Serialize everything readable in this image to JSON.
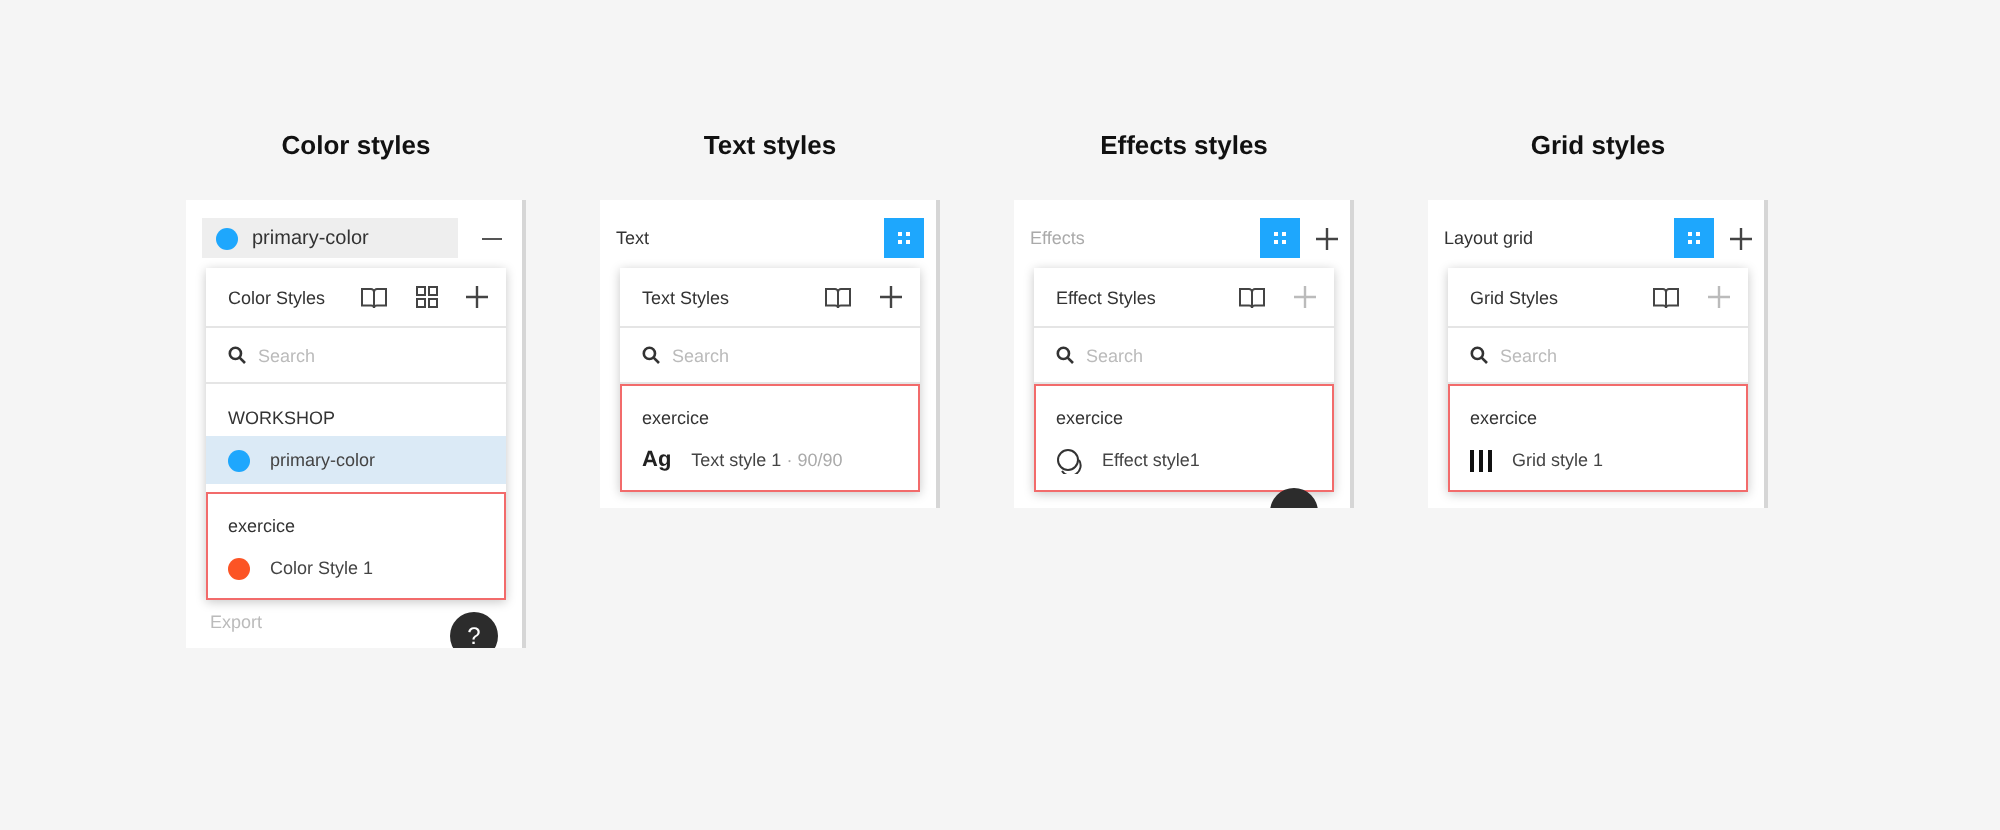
{
  "panels": [
    {
      "heading": "Color styles",
      "section": {
        "kind": "swatch-field",
        "label": "primary-color",
        "color": "#1ea7fd",
        "plus": false
      },
      "popup": {
        "title": "Color Styles",
        "tools": [
          {
            "kind": "library"
          },
          {
            "kind": "grid"
          },
          {
            "kind": "add",
            "disabled": false
          }
        ],
        "placeholder": "Search",
        "groups": [
          {
            "name": "WORKSHOP",
            "highlighted": false,
            "items": [
              {
                "kind": "color",
                "color": "#1ea7fd",
                "label": "primary-color",
                "selected": true
              }
            ]
          },
          {
            "name": "exercice",
            "highlighted": true,
            "items": [
              {
                "kind": "color",
                "color": "#fc5425",
                "label": "Color Style 1",
                "selected": false
              }
            ]
          }
        ]
      },
      "footer": "Export",
      "help": "?"
    },
    {
      "heading": "Text styles",
      "section": {
        "kind": "label",
        "label": "Text",
        "disabled": false,
        "plus": false
      },
      "popup": {
        "title": "Text Styles",
        "tools": [
          {
            "kind": "library"
          },
          {
            "kind": "add",
            "disabled": false
          }
        ],
        "placeholder": "Search",
        "groups": [
          {
            "name": "exercice",
            "highlighted": true,
            "items": [
              {
                "kind": "text",
                "glyph": "Ag",
                "label": "Text style 1",
                "detail": "· 90/90",
                "selected": false
              }
            ]
          }
        ]
      }
    },
    {
      "heading": "Effects styles",
      "section": {
        "kind": "label",
        "label": "Effects",
        "disabled": true,
        "plus": true
      },
      "popup": {
        "title": "Effect Styles",
        "tools": [
          {
            "kind": "library"
          },
          {
            "kind": "add",
            "disabled": true
          }
        ],
        "placeholder": "Search",
        "groups": [
          {
            "name": "exercice",
            "highlighted": true,
            "items": [
              {
                "kind": "effect",
                "label": "Effect style1",
                "selected": false
              }
            ]
          }
        ]
      },
      "help_partial": true
    },
    {
      "heading": "Grid styles",
      "section": {
        "kind": "label",
        "label": "Layout grid",
        "disabled": false,
        "plus": true
      },
      "popup": {
        "title": "Grid Styles",
        "tools": [
          {
            "kind": "library"
          },
          {
            "kind": "add",
            "disabled": true
          }
        ],
        "placeholder": "Search",
        "groups": [
          {
            "name": "exercice",
            "highlighted": true,
            "items": [
              {
                "kind": "grid",
                "label": "Grid style 1",
                "selected": false
              }
            ]
          }
        ]
      }
    }
  ]
}
